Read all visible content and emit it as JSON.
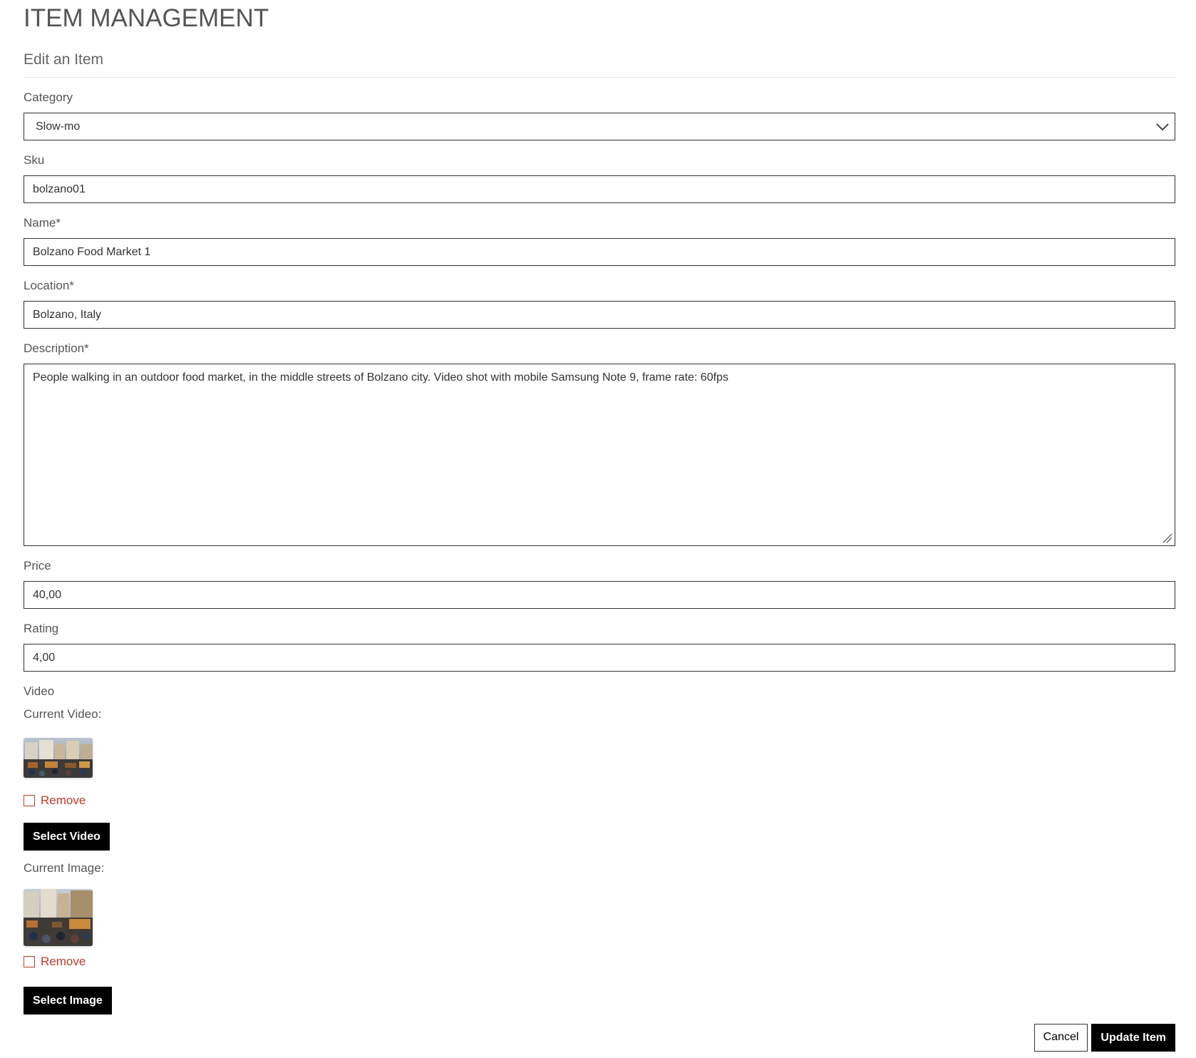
{
  "header": {
    "title": "ITEM MANAGEMENT",
    "subtitle": "Edit an Item"
  },
  "form": {
    "category": {
      "label": "Category",
      "value": "Slow-mo"
    },
    "sku": {
      "label": "Sku",
      "value": "bolzano01"
    },
    "name": {
      "label": "Name*",
      "value": "Bolzano Food Market 1"
    },
    "location": {
      "label": "Location*",
      "value": "Bolzano, Italy"
    },
    "description": {
      "label": "Description*",
      "value": "People walking in an outdoor food market, in the middle streets of Bolzano city. Video shot with mobile Samsung Note 9, frame rate: 60fps"
    },
    "price": {
      "label": "Price",
      "value": "40,00"
    },
    "rating": {
      "label": "Rating",
      "value": "4,00"
    },
    "video": {
      "label": "Video",
      "current_label": "Current Video:",
      "remove_label": "Remove",
      "select_button": "Select Video"
    },
    "image": {
      "current_label": "Current Image:",
      "remove_label": "Remove",
      "select_button": "Select Image"
    }
  },
  "actions": {
    "cancel_label": "Cancel",
    "submit_label": "Update Item"
  },
  "colors": {
    "remove": "#c0392b",
    "button_dark": "#000000",
    "border": "#333333"
  }
}
